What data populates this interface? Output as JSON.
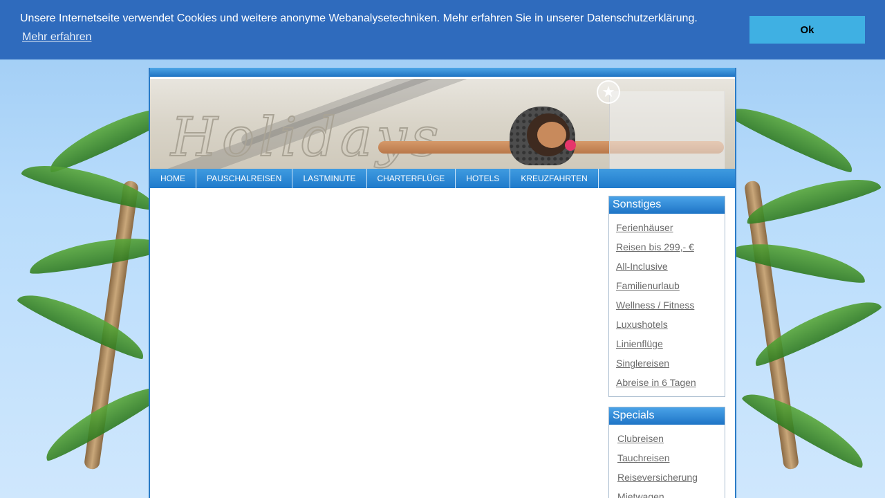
{
  "cookie_banner": {
    "message": "Unsere Internetseite verwendet Cookies und weitere anonyme Webanalysetechniken. Mehr erfahren Sie in unserer Datenschutzerklärung.",
    "learn_more": "Mehr erfahren",
    "ok_label": "Ok"
  },
  "nav": {
    "items": [
      "HOME",
      "PAUSCHALREISEN",
      "LASTMINUTE",
      "CHARTERFLÜGE",
      "HOTELS",
      "KREUZFAHRTEN"
    ]
  },
  "sidebar": {
    "sonstiges": {
      "title": "Sonstiges",
      "links": [
        "Ferienhäuser",
        "Reisen bis 299,- €",
        "All-Inclusive",
        "Familienurlaub",
        "Wellness / Fitness",
        "Luxushotels",
        "Linienflüge",
        "Singlereisen",
        "Abreise in 6 Tagen"
      ]
    },
    "specials": {
      "title": "Specials",
      "links": [
        "Clubreisen",
        "Tauchreisen",
        "Reiseversicherung",
        "Mietwagen"
      ]
    }
  },
  "colors": {
    "banner_bg": "#2f6bbd",
    "ok_button": "#3fb0e3",
    "nav_bg": "#1f7acb",
    "page_bg": "#b8dcfb"
  },
  "icons": {
    "starfish": "starfish-icon"
  }
}
